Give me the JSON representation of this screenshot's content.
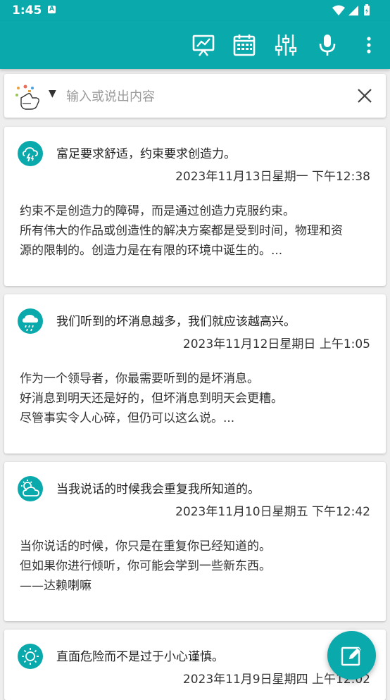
{
  "status_bar": {
    "time": "1:45",
    "notification_badge": "A"
  },
  "toolbar": {
    "icons": [
      "chart-screen-icon",
      "calendar-icon",
      "sliders-icon",
      "microphone-icon",
      "more-vert-icon"
    ]
  },
  "search": {
    "placeholder": "输入或说出内容",
    "value": ""
  },
  "entries": [
    {
      "weather_icon": "thunderstorm-icon",
      "title": "富足要求舒适，约束要求创造力。",
      "date": "2023年11月13日星期一 下午12:38",
      "body": [
        "约束不是创造力的障碍，而是通过创造力克服约束。",
        "所有伟大的作品或创造性的解决方案都是受到时间，物理和资",
        "源的限制的。创造力是在有限的环境中诞生的。..."
      ]
    },
    {
      "weather_icon": "rain-icon",
      "title": "我们听到的坏消息越多，我们就应该越高兴。",
      "date": "2023年11月12日星期日 上午1:05",
      "body": [
        "作为一个领导者，你最需要听到的是坏消息。",
        "好消息到明天还是好的，但坏消息到明天会更糟。",
        "尽管事实令人心碎，但仍可以这么说。..."
      ]
    },
    {
      "weather_icon": "partly-cloudy-icon",
      "title": "当我说话的时候我会重复我所知道的。",
      "date": "2023年11月10日星期五 下午12:42",
      "body": [
        "当你说话的时候，你只是在重复你已经知道的。",
        "但如果你进行倾听，你可能会学到一些新东西。",
        "——达赖喇嘛"
      ]
    },
    {
      "weather_icon": "sunny-icon",
      "title": "直面危险而不是过于小心谨慎。",
      "date": "2023年11月9日星期四 上午12:02",
      "body": []
    }
  ],
  "colors": {
    "primary": "#0aa9ac",
    "background": "#eeeeee",
    "card": "#ffffff"
  },
  "fab": {
    "icon": "edit-note-icon"
  }
}
